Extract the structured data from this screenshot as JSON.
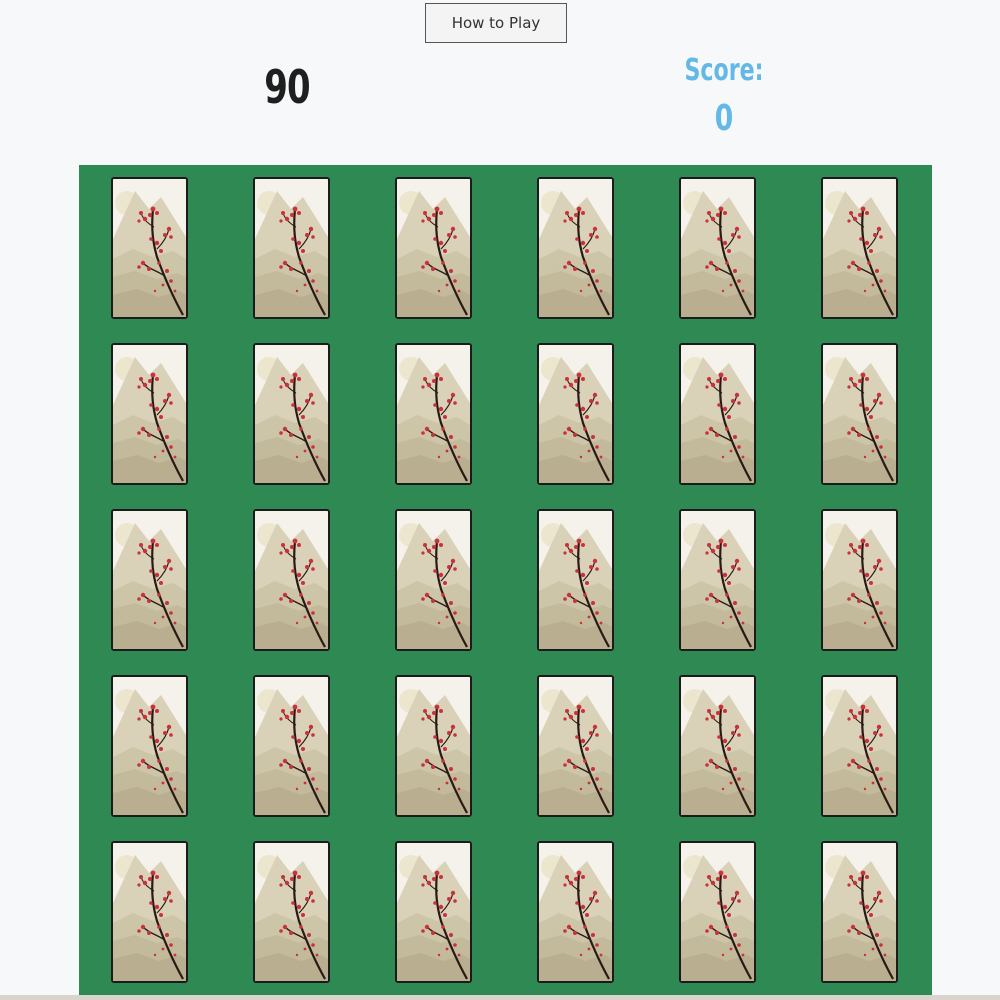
{
  "header": {
    "how_to_play_label": "How to Play",
    "timer_value": "90",
    "score_label": "Score:",
    "score_value": "0"
  },
  "colors": {
    "board_background": "#2e8a52",
    "score_text": "#63b8e6",
    "card_back_sky": "#f4f2ea",
    "card_back_mountain": "#d9d2b8",
    "card_back_blossom": "#c9313d"
  },
  "board": {
    "rows": 5,
    "columns": 6,
    "card_state": "face-down",
    "card_back_icon": "mountain-cherry-blossom-card-back-icon"
  }
}
